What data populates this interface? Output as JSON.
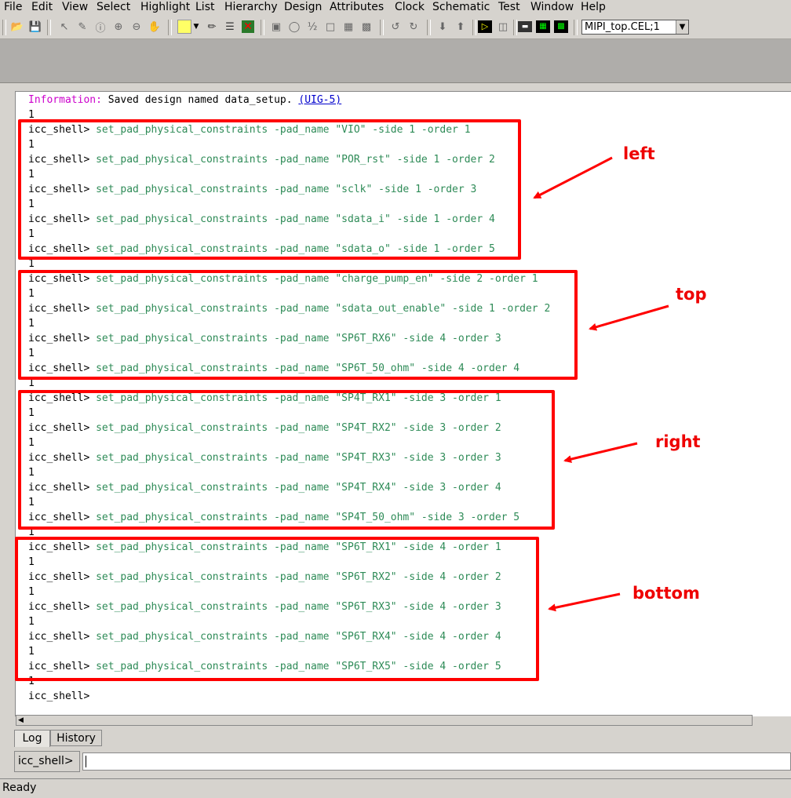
{
  "menubar": {
    "items": [
      "File",
      "Edit",
      "View",
      "Select",
      "Highlight",
      "List",
      "Hierarchy",
      "Design",
      "Attributes",
      "Clock",
      "Schematic",
      "Test",
      "Window",
      "Help"
    ]
  },
  "toolbar": {
    "cell_selector_value": "MIPI_top.CEL;1"
  },
  "log": {
    "info_label": "Information:",
    "info_text": " Saved design named data_setup. ",
    "info_link": "(UIG-5)",
    "prompt": "icc_shell> ",
    "result": "1",
    "commands": [
      "set_pad_physical_constraints -pad_name \"VIO\" -side 1 -order 1",
      "set_pad_physical_constraints -pad_name \"POR_rst\" -side 1 -order 2",
      "set_pad_physical_constraints -pad_name \"sclk\" -side 1 -order 3",
      "set_pad_physical_constraints -pad_name \"sdata_i\" -side 1 -order 4",
      "set_pad_physical_constraints -pad_name \"sdata_o\" -side 1 -order 5",
      "set_pad_physical_constraints -pad_name \"charge_pump_en\" -side 2 -order 1",
      "set_pad_physical_constraints -pad_name \"sdata_out_enable\" -side 1 -order 2",
      "set_pad_physical_constraints -pad_name \"SP6T_RX6\" -side 4 -order 3",
      "set_pad_physical_constraints -pad_name \"SP6T_50_ohm\" -side 4 -order 4",
      "set_pad_physical_constraints -pad_name \"SP4T_RX1\" -side 3 -order 1",
      "set_pad_physical_constraints -pad_name \"SP4T_RX2\" -side 3 -order 2",
      "set_pad_physical_constraints -pad_name \"SP4T_RX3\" -side 3 -order 3",
      "set_pad_physical_constraints -pad_name \"SP4T_RX4\" -side 3 -order 4",
      "set_pad_physical_constraints -pad_name \"SP4T_50_ohm\" -side 3 -order 5",
      "set_pad_physical_constraints -pad_name \"SP6T_RX1\" -side 4 -order 1",
      "set_pad_physical_constraints -pad_name \"SP6T_RX2\" -side 4 -order 2",
      "set_pad_physical_constraints -pad_name \"SP6T_RX3\" -side 4 -order 3",
      "set_pad_physical_constraints -pad_name \"SP6T_RX4\" -side 4 -order 4",
      "set_pad_physical_constraints -pad_name \"SP6T_RX5\" -side 4 -order 5"
    ],
    "final_prompt": "icc_shell>"
  },
  "annotations": {
    "left": "left",
    "top": "top",
    "right": "right",
    "bottom": "bottom",
    "color": "#ff0000"
  },
  "tabs": [
    "Log",
    "History"
  ],
  "command_line": {
    "label": "icc_shell>",
    "value": ""
  },
  "status": "Ready"
}
